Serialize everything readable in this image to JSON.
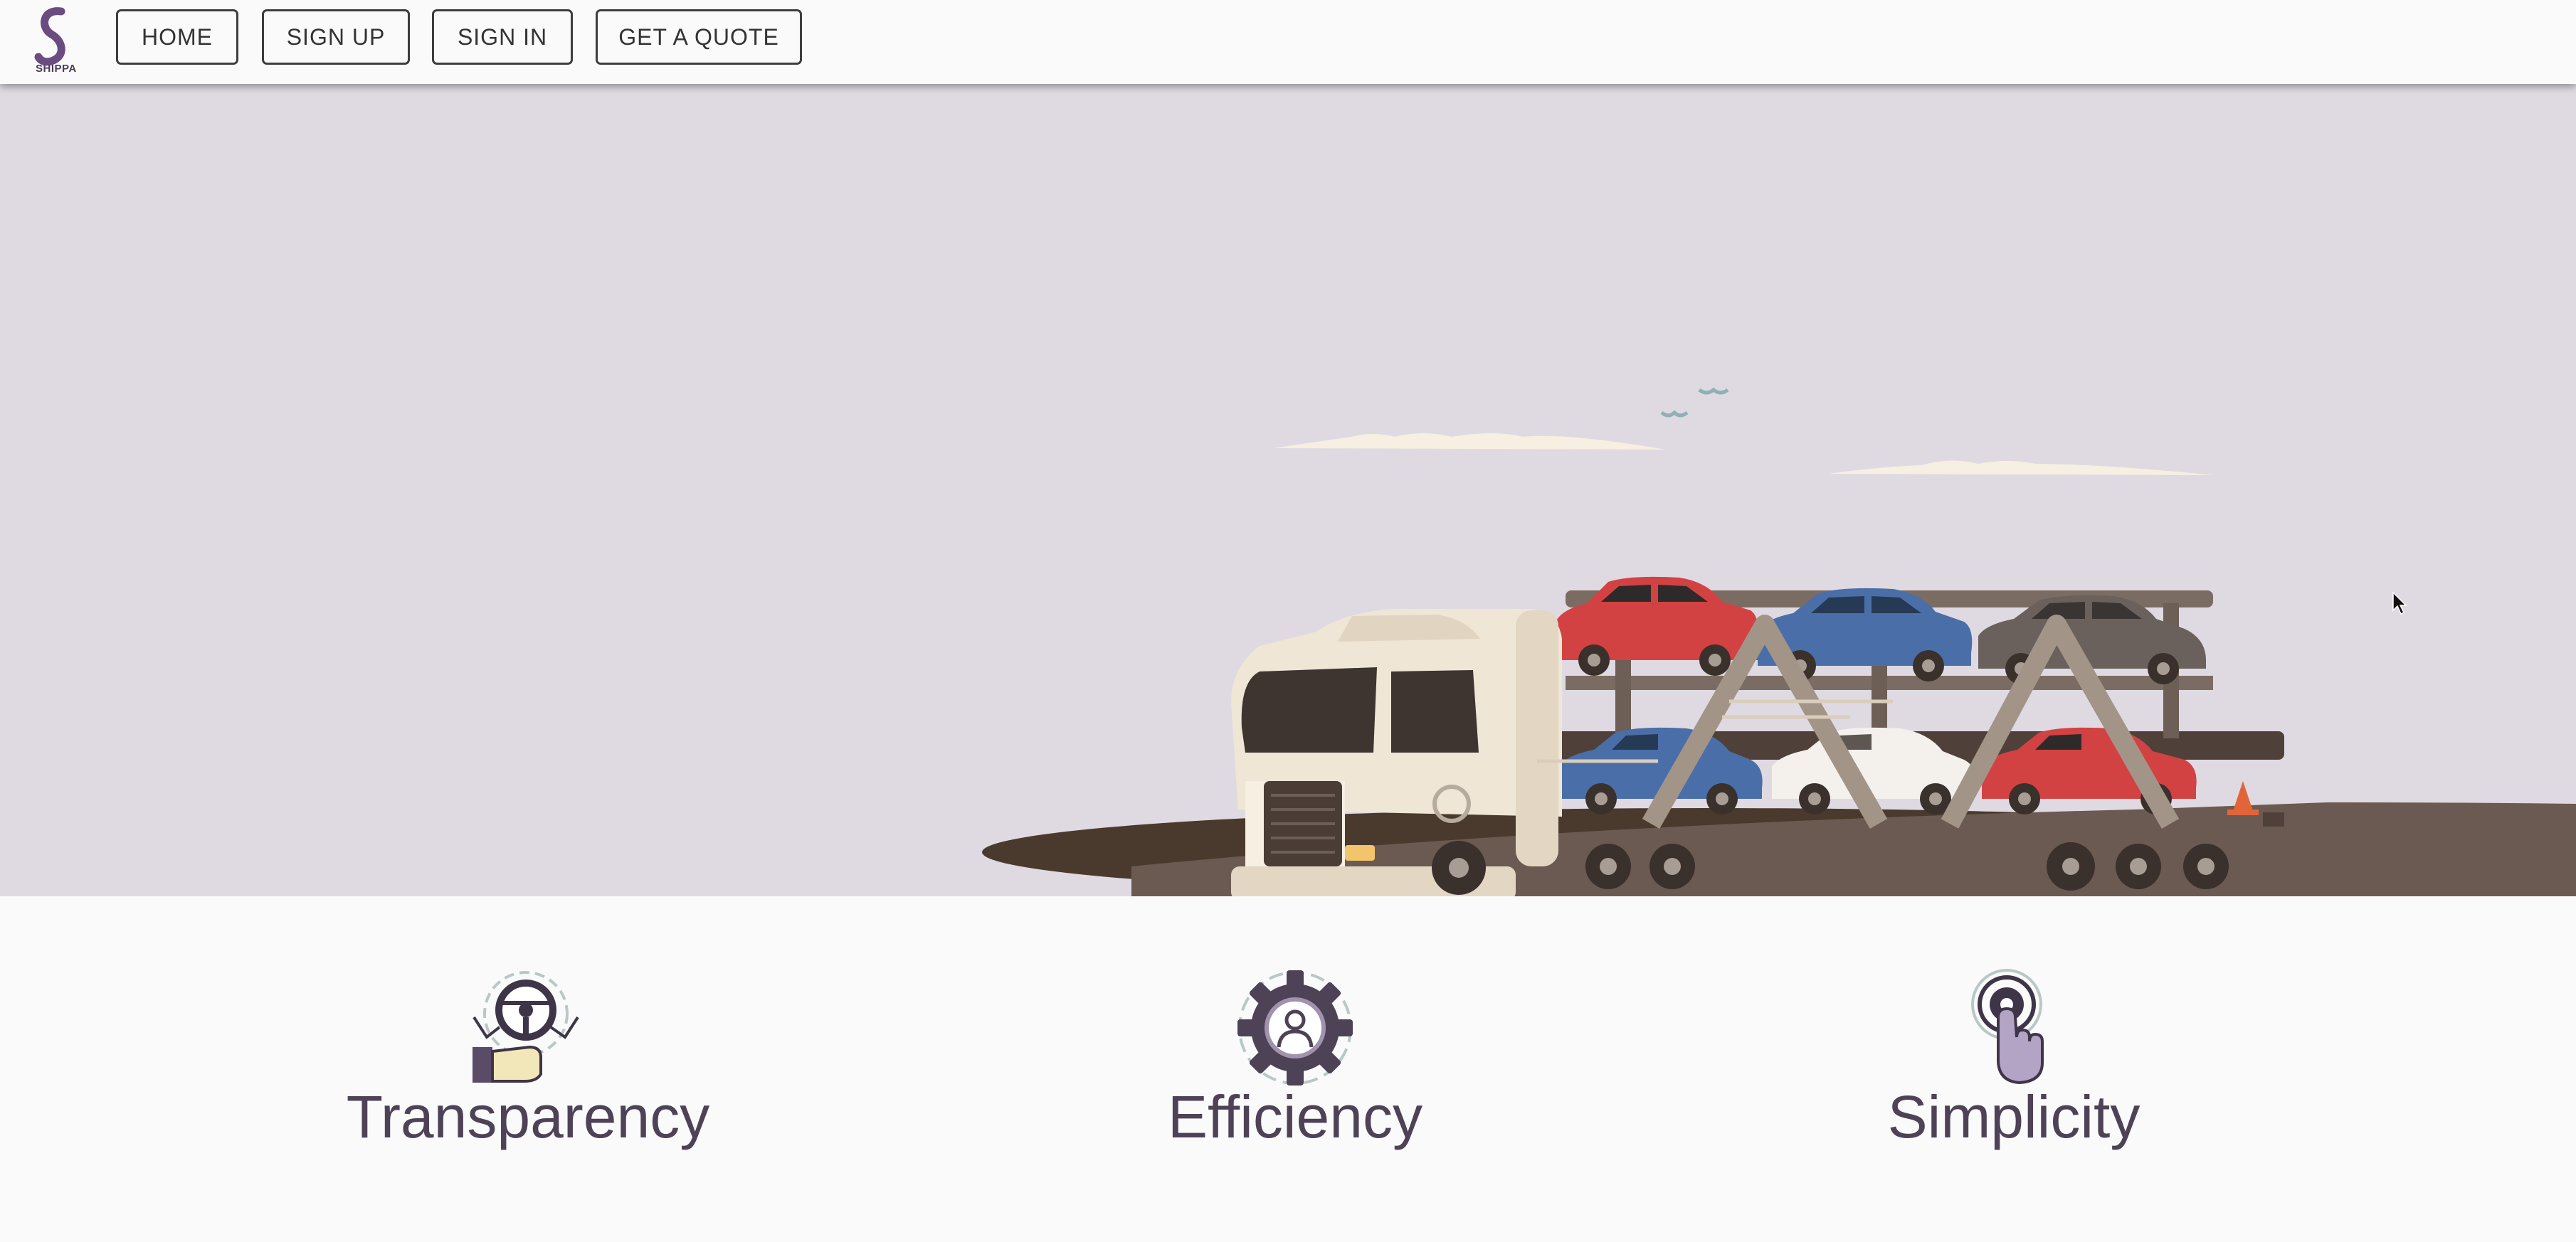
{
  "app": {
    "logo_text": "SHIPPA"
  },
  "nav": {
    "home": "HOME",
    "sign_up": "SIGN UP",
    "sign_in": "SIGN IN",
    "get_quote": "GET A QUOTE"
  },
  "hero": {
    "illustration": "car-carrier-truck"
  },
  "features": [
    {
      "title": "Transparency",
      "icon": "steering-magnifier-icon"
    },
    {
      "title": "Efficiency",
      "icon": "gear-person-icon"
    },
    {
      "title": "Simplicity",
      "icon": "touch-target-icon"
    }
  ],
  "colors": {
    "hero_bg": "#dfdae2",
    "accent": "#4e4257",
    "ground": "#6b5a51"
  }
}
